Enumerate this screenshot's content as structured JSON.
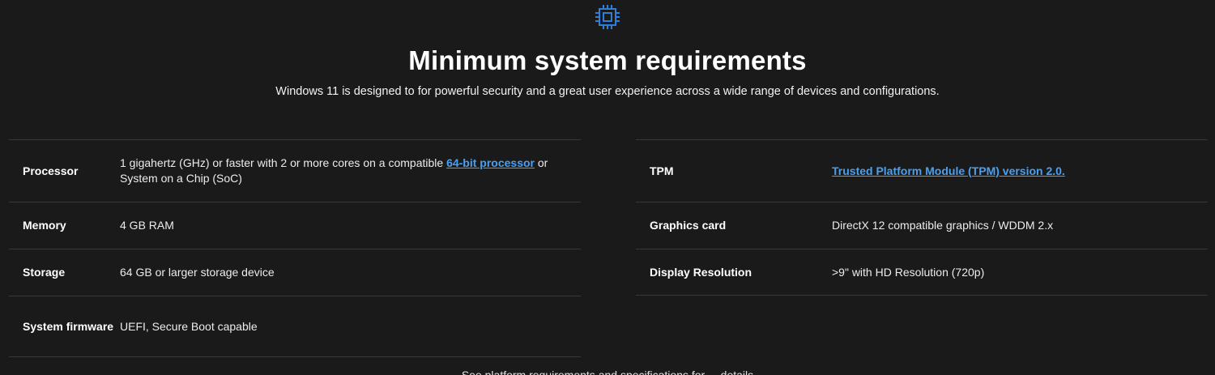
{
  "icon": {
    "name": "chip-icon",
    "color": "#2f7fd8"
  },
  "header": {
    "title": "Minimum system requirements",
    "subtitle": "Windows 11 is designed to for powerful security and a great user experience across a wide range of devices and configurations."
  },
  "left_table": {
    "rows": [
      {
        "label": "Processor",
        "value_before": "1 gigahertz (GHz) or faster with 2 or more cores on a compatible",
        "link": "64-bit processor",
        "value_after": "or System on a Chip (SoC)"
      },
      {
        "label": "Memory",
        "value": "4 GB RAM"
      },
      {
        "label": "Storage",
        "value": "64 GB or larger storage device"
      },
      {
        "label": "System firmware",
        "value": "UEFI, Secure Boot capable"
      }
    ]
  },
  "right_table": {
    "rows": [
      {
        "label": "TPM",
        "link": "Trusted Platform Module (TPM) version 2.0."
      },
      {
        "label": "Graphics card",
        "value": "DirectX 12 compatible graphics / WDDM 2.x"
      },
      {
        "label": "Display Resolution",
        "value": ">9\" with HD Resolution (720p)"
      }
    ]
  },
  "colors": {
    "background": "#1b1a1a",
    "divider": "#3a3939",
    "link": "#4aa0f0",
    "accent": "#2f7fd8"
  },
  "footer": {
    "partial_text": "See platform requirements and specifications for ... details"
  }
}
